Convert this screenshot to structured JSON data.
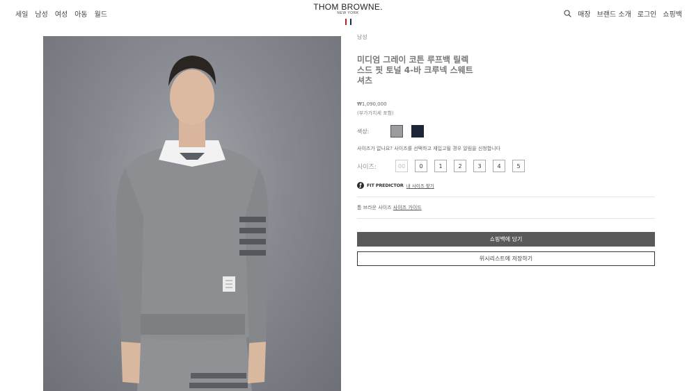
{
  "nav": {
    "left": [
      "세일",
      "남성",
      "여성",
      "아동",
      "월드"
    ],
    "right": [
      "매장",
      "브랜드 소개",
      "로그인",
      "쇼핑백"
    ]
  },
  "brand": {
    "name": "THOM BROWNE.",
    "sub": "NEW YORK",
    "flag_colors": [
      "#b3232e",
      "#1f2a4a"
    ]
  },
  "icons": {
    "search": "search-icon",
    "fit": "fit-predictor-icon"
  },
  "product": {
    "breadcrumb": "남성",
    "title": "미디엄 그레이 코튼 루프백 릴렉스드 핏 토널 4-바 크루넥 스웨트셔츠",
    "price": "₩1,090,000",
    "vat": "(부가가치세 포함)",
    "color_label": "색상:",
    "colors": [
      "#9a9ca0",
      "#1d2538"
    ],
    "size_note": "사이즈가 없나요? 사이즈를 선택하고 재입고될 경우 알림을 신청합니다",
    "size_label": "사이즈:",
    "sizes": [
      "00",
      "0",
      "1",
      "2",
      "3",
      "4",
      "5"
    ],
    "fit_title": "FIT PREDICTOR",
    "fit_link": "내 사이즈 찾기",
    "guide_text": "톰 브라운 사이즈",
    "guide_link": "사이즈 가이드",
    "add_to_bag": "쇼핑백에 담기",
    "wishlist": "위시리스트에 저장하기"
  }
}
